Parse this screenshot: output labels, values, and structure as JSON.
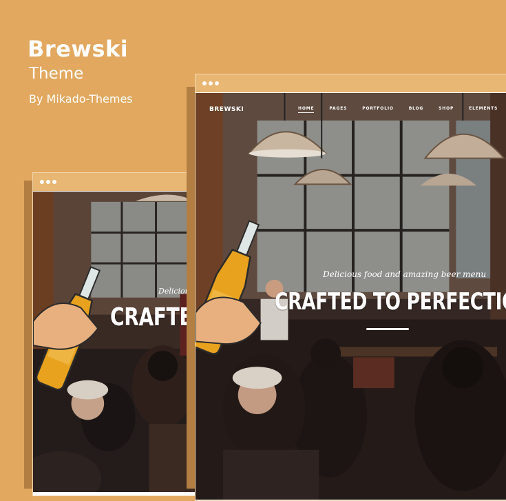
{
  "product": {
    "name": "Brewski",
    "type": "Theme",
    "author": "By Mikado-Themes"
  },
  "desktop_preview": {
    "logo": "BREWSKI",
    "nav": [
      "HOME",
      "PAGES",
      "PORTFOLIO",
      "BLOG",
      "SHOP",
      "ELEMENTS"
    ],
    "tagline": "Delicious food and amazing beer menu",
    "headline": "CRAFTED TO PERFECTION"
  },
  "mobile_preview": {
    "tagline": "Delicious fo",
    "headline": "CRAFTED"
  },
  "colors": {
    "background": "#e2a85f",
    "window_bar": "#e8b774",
    "shadow": "#b27e42"
  }
}
